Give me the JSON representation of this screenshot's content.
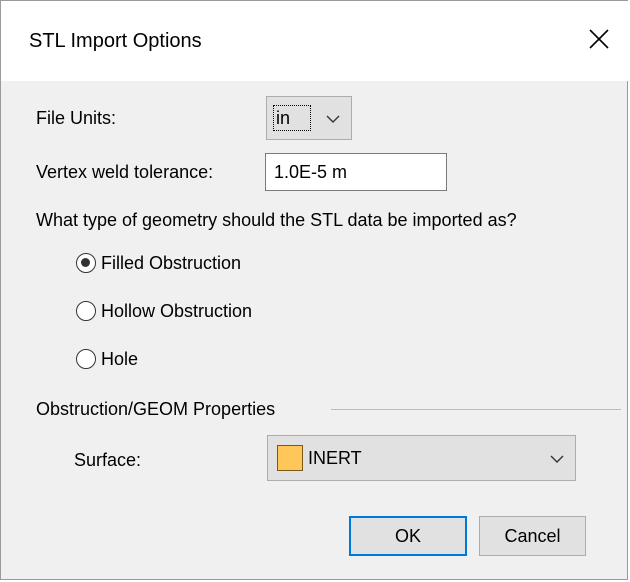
{
  "window": {
    "title": "STL Import Options"
  },
  "file_units": {
    "label": "File Units:",
    "value": "in"
  },
  "tolerance": {
    "label": "Vertex weld tolerance:",
    "value": "1.0E-5 m"
  },
  "geometry": {
    "question": "What type of geometry should the STL data be imported as?",
    "options": [
      {
        "label": "Filled Obstruction",
        "checked": true
      },
      {
        "label": "Hollow Obstruction",
        "checked": false
      },
      {
        "label": "Hole",
        "checked": false
      }
    ]
  },
  "properties": {
    "group_label": "Obstruction/GEOM Properties",
    "surface_label": "Surface:",
    "surface_value": "INERT",
    "surface_color": "#ffc65a"
  },
  "buttons": {
    "ok": "OK",
    "cancel": "Cancel"
  },
  "colors": {
    "accent": "#0078d7",
    "background": "#f0f0f0"
  }
}
